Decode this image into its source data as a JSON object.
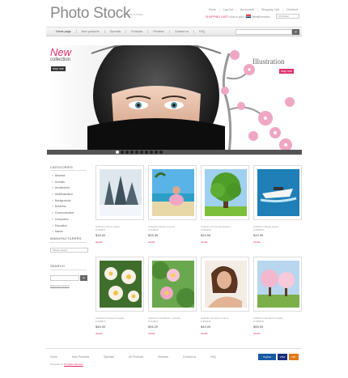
{
  "header": {
    "logo": "Photo Stock",
    "tagline": "ONLINE STORE",
    "top_links": [
      "Home",
      "Log Out",
      "My Account",
      "Shopping Cart",
      "Checkout"
    ],
    "cart_label": "SHOPPING CART:",
    "cart_text": "Now in your cart 0 items",
    "currency_label": "Currencies",
    "currency_value": "US Dollar"
  },
  "nav": {
    "items": [
      "Home page",
      "New products",
      "Specials",
      "Products",
      "Reviews",
      "Contact us",
      "FAQ"
    ],
    "search_value": "",
    "go": "go"
  },
  "banner": {
    "new": "New",
    "collection": "collection",
    "shop_now": "shop now",
    "illustration": "Illustration",
    "shop_now_2": "shop now",
    "active_slide": 1,
    "slide_count": 10
  },
  "sidebar": {
    "categories_title": "CATEGORIES",
    "categories": [
      "Abstract",
      "Animals",
      "Architecture",
      "Art&Illustration",
      "Backgrounds",
      "Business",
      "Communication",
      "Computers",
      "Education",
      "Nature"
    ],
    "manufacturers_title": "MANUFACTURERS",
    "manufacturers_select": "Please Select",
    "search_title": "SEARCH",
    "search_go": "go",
    "advanced_search": "Advanced Search"
  },
  "products": [
    {
      "name": "collection Nemo ipsum",
      "sku": "# 256874",
      "price": "$15.00",
      "details": "details"
    },
    {
      "name": "collection Dolore et amet",
      "sku": "# 216523",
      "price": "$25.35",
      "details": "details"
    },
    {
      "name": "collection Porta consectetur",
      "sku": "# 362439",
      "price": "$19.99",
      "details": "details"
    },
    {
      "name": "collection Neque augue",
      "sku": "# 296548",
      "price": "$19.99",
      "details": "details"
    },
    {
      "name": "collection Praesent feugiat",
      "sku": "# 356874",
      "price": "$45.00",
      "details": "details"
    },
    {
      "name": "collection Vestibulum molestie",
      "sku": "# 216523",
      "price": "$26.20",
      "details": "details"
    },
    {
      "name": "collection Aenean tempus",
      "sku": "# 362439",
      "price": "$49.00",
      "details": "details"
    },
    {
      "name": "collection Hendrerit fringilla",
      "sku": "# 296548",
      "price": "$55.00",
      "details": "details"
    }
  ],
  "footer": {
    "links": [
      "Home",
      "New Products",
      "Specials",
      "All Products",
      "Reviews",
      "Contact us",
      "FAQ"
    ],
    "copyright_text": "Template by",
    "copyright_link": "Template Monster",
    "payments": [
      "PayPal",
      "VISA",
      "MC"
    ]
  },
  "colors": {
    "accent": "#e0306e",
    "nav_bg": "#eeeeee"
  }
}
